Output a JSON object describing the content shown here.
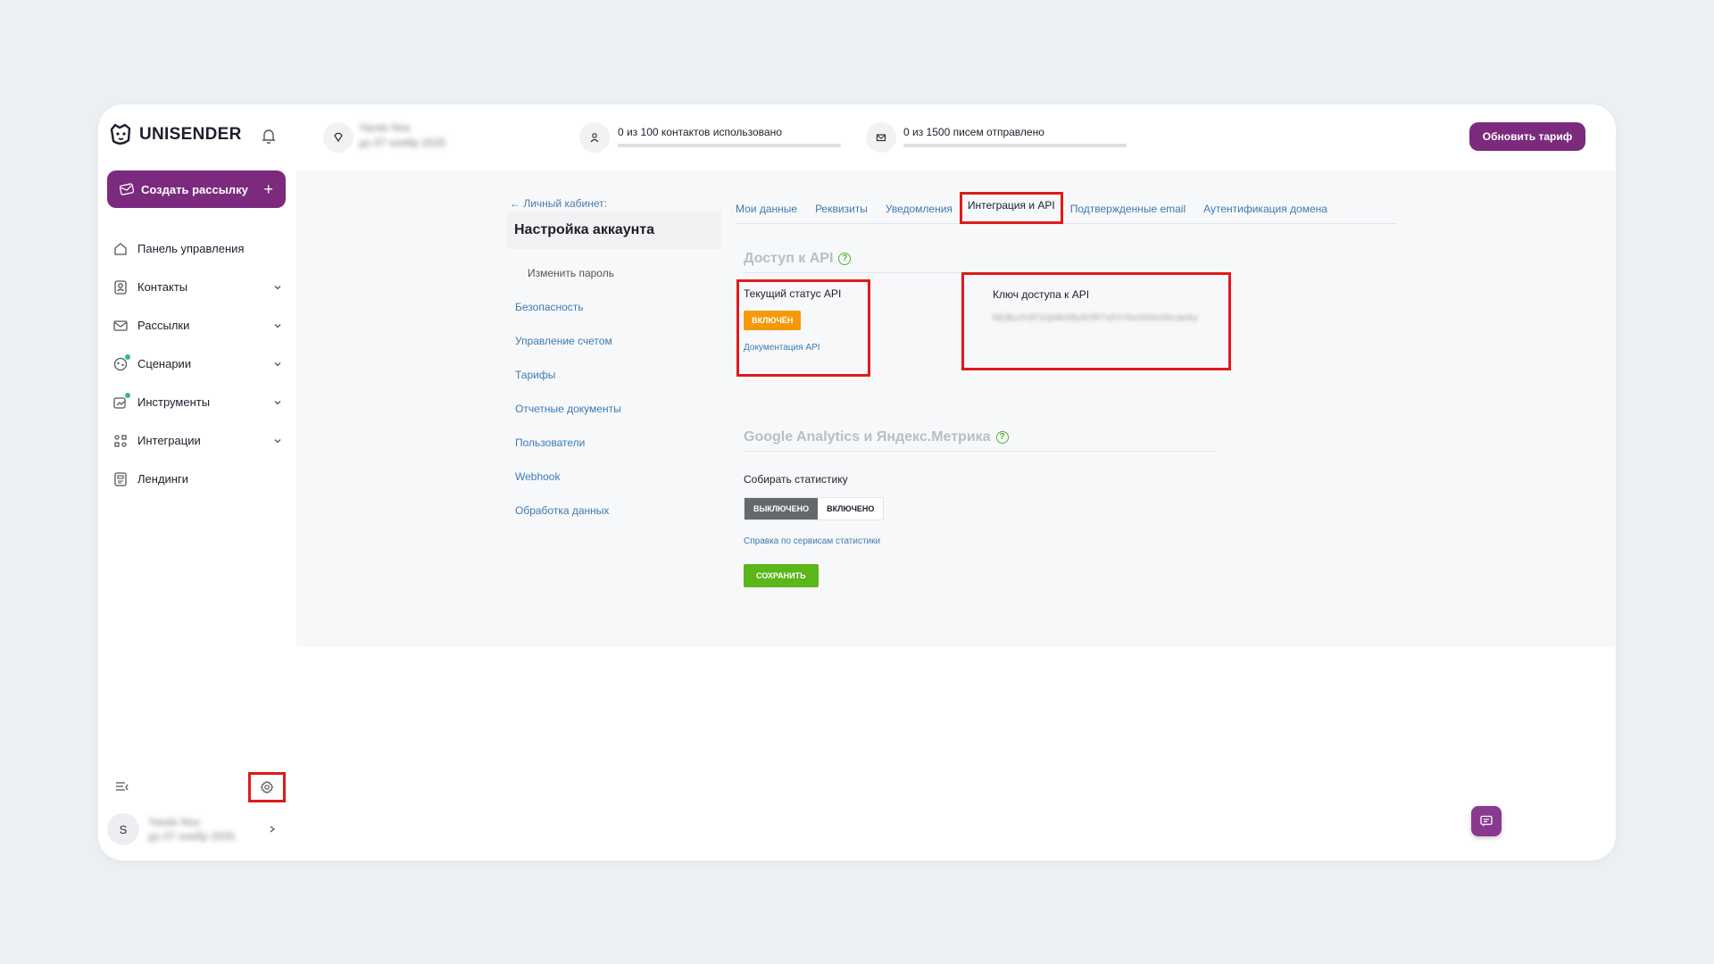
{
  "brand": {
    "name": "UNISENDER",
    "accent": "#7b2a7e"
  },
  "sidebar": {
    "create_label": "Создать рассылку",
    "items": [
      {
        "label": "Панель управления",
        "icon": "home-icon",
        "chevron": false
      },
      {
        "label": "Контакты",
        "icon": "contacts-icon",
        "chevron": true
      },
      {
        "label": "Рассылки",
        "icon": "mail-icon",
        "chevron": true
      },
      {
        "label": "Сценарии",
        "icon": "scenario-icon",
        "chevron": true
      },
      {
        "label": "Инструменты",
        "icon": "tools-icon",
        "chevron": true
      },
      {
        "label": "Интеграции",
        "icon": "integrations-icon",
        "chevron": true
      },
      {
        "label": "Лендинги",
        "icon": "landing-icon",
        "chevron": false
      }
    ],
    "user": {
      "initial": "S",
      "name": "Yandx Nox",
      "sub": "до 07 ноябр 2025"
    }
  },
  "topbar": {
    "plan_name": "Yandx Nox",
    "plan_sub": "до 07 ноябр 2025",
    "contacts_stat": "0 из 100 контактов использовано",
    "contacts_progress": 0,
    "emails_stat": "0 из 1500 писем отправлено",
    "emails_progress": 0,
    "upgrade_label": "Обновить тариф"
  },
  "settings": {
    "back_link": "← Личный кабинет:",
    "title": "Настройка аккаунта",
    "change_password": "Изменить пароль",
    "menu": [
      "Безопасность",
      "Управление счетом",
      "Тарифы",
      "Отчетные документы",
      "Пользователи",
      "Webhook",
      "Обработка данных"
    ]
  },
  "tabs": [
    "Мои данные",
    "Реквизиты",
    "Уведомления",
    "Интеграция и API",
    "Подтвержденные email",
    "Аутентификация домена"
  ],
  "api": {
    "section_title": "Доступ к API",
    "status_label": "Текущий статус API",
    "status_value": "ВКЛЮЧЁН",
    "docs_link": "Документация API",
    "key_label": "Ключ доступа к API",
    "key_value": "6EjBurh3F3Jp6k5By8rfR7s6Yr5wXKbo5kcaeby"
  },
  "analytics": {
    "section_title": "Google Analytics и Яндекс.Метрика",
    "collect_label": "Собирать статистику",
    "off_label": "ВЫКЛЮЧЕНО",
    "on_label": "ВКЛЮЧЕНО",
    "help_link": "Справка по сервисам статистики",
    "save_label": "СОХРАНИТЬ"
  }
}
